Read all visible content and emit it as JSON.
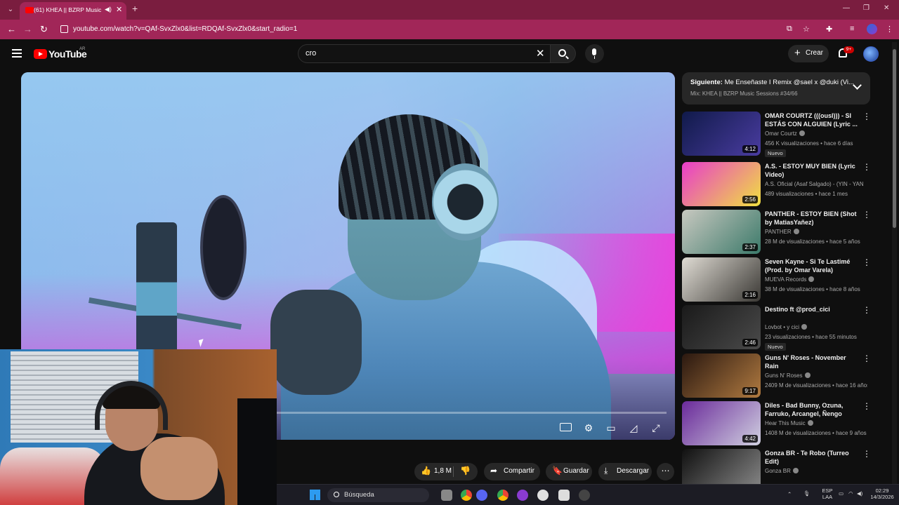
{
  "browser": {
    "tab_title": "(61) KHEA || BZRP Music Se",
    "url": "youtube.com/watch?v=QAf-SvxZlx0&list=RDQAf-SvxZlx0&start_radio=1"
  },
  "header": {
    "logo_text": "YouTube",
    "region": "AR",
    "search_value": "cro",
    "create_label": "Crear",
    "notifications_badge": "9+"
  },
  "player": {
    "progress_fraction": 0.0
  },
  "actions": {
    "likes": "1,8 M",
    "share": "Compartir",
    "save": "Guardar",
    "download": "Descargar"
  },
  "upnext": {
    "prefix": "Siguiente:",
    "title": "Me Enseñaste I Remix @sael x @duki (Vi...",
    "subtitle": "Mix: KHEA || BZRP Music Sessions #34/66"
  },
  "recommendations": [
    {
      "title": "OMAR COURTZ (((ousl))) - SI ESTÁS CON ALGUIEN (Lyric ...",
      "channel": "Omar Courtz",
      "verified": true,
      "meta": "456 K visualizaciones • hace 6 días",
      "duration": "4:12",
      "badge": "Nuevo",
      "thumb_colors": [
        "#101a4a",
        "#4a3ca0"
      ]
    },
    {
      "title": "A.S. - ESTOY MUY BIEN (Lyric Video) #NeoReal_ElMovimiento",
      "channel": "A.S. Oficial (Asaf Salgado) - (YIN - YANG).",
      "verified": false,
      "meta": "489 visualizaciones • hace 1 mes",
      "duration": "2:56",
      "badge": "",
      "thumb_colors": [
        "#e83ccb",
        "#f0e040"
      ]
    },
    {
      "title": "PANTHER - ESTOY BIEN (Shot by MatiasYañez)",
      "channel": "PANTHER",
      "verified": true,
      "meta": "28 M de visualizaciones • hace 5 años",
      "duration": "2:37",
      "badge": "",
      "thumb_colors": [
        "#c8c8c0",
        "#3c7a6a"
      ]
    },
    {
      "title": "Seven Kayne - Si Te Lastimé (Prod. by Omar Varela)",
      "channel": "MUEVA Records",
      "verified": true,
      "meta": "38 M de visualizaciones • hace 8 años",
      "duration": "2:16",
      "badge": "",
      "thumb_colors": [
        "#e0dcd4",
        "#3a3834"
      ]
    },
    {
      "title": "Destino ft @prod_cici",
      "channel": "Lovbot • y cici",
      "verified": true,
      "meta": "23 visualizaciones • hace 55 minutos",
      "duration": "2:46",
      "badge": "Nuevo",
      "thumb_colors": [
        "#1a1a1a",
        "#4a4a4a"
      ]
    },
    {
      "title": "Guns N' Roses - November Rain",
      "channel": "Guns N' Roses",
      "verified": true,
      "meta": "2409 M de visualizaciones • hace 16 años",
      "duration": "9:17",
      "badge": "",
      "thumb_colors": [
        "#2a1810",
        "#b07a40"
      ]
    },
    {
      "title": "Diles - Bad Bunny, Ozuna, Farruko, Arcangel, Ñengo Flow",
      "channel": "Hear This Music",
      "verified": true,
      "meta": "1408 M de visualizaciones • hace 9 años",
      "duration": "4:42",
      "badge": "",
      "thumb_colors": [
        "#6a2a9a",
        "#d0d0e0"
      ]
    },
    {
      "title": "Gonza BR - Te Robo (Turreo Edit)",
      "channel": "Gonza BR",
      "verified": true,
      "meta": "",
      "duration": "",
      "badge": "",
      "thumb_colors": [
        "#101010",
        "#8a8a8a"
      ]
    }
  ],
  "taskbar": {
    "search_label": "Búsqueda",
    "lang": "ESP",
    "region": "LAA",
    "time": "02:29",
    "date": "14/3/2026"
  }
}
